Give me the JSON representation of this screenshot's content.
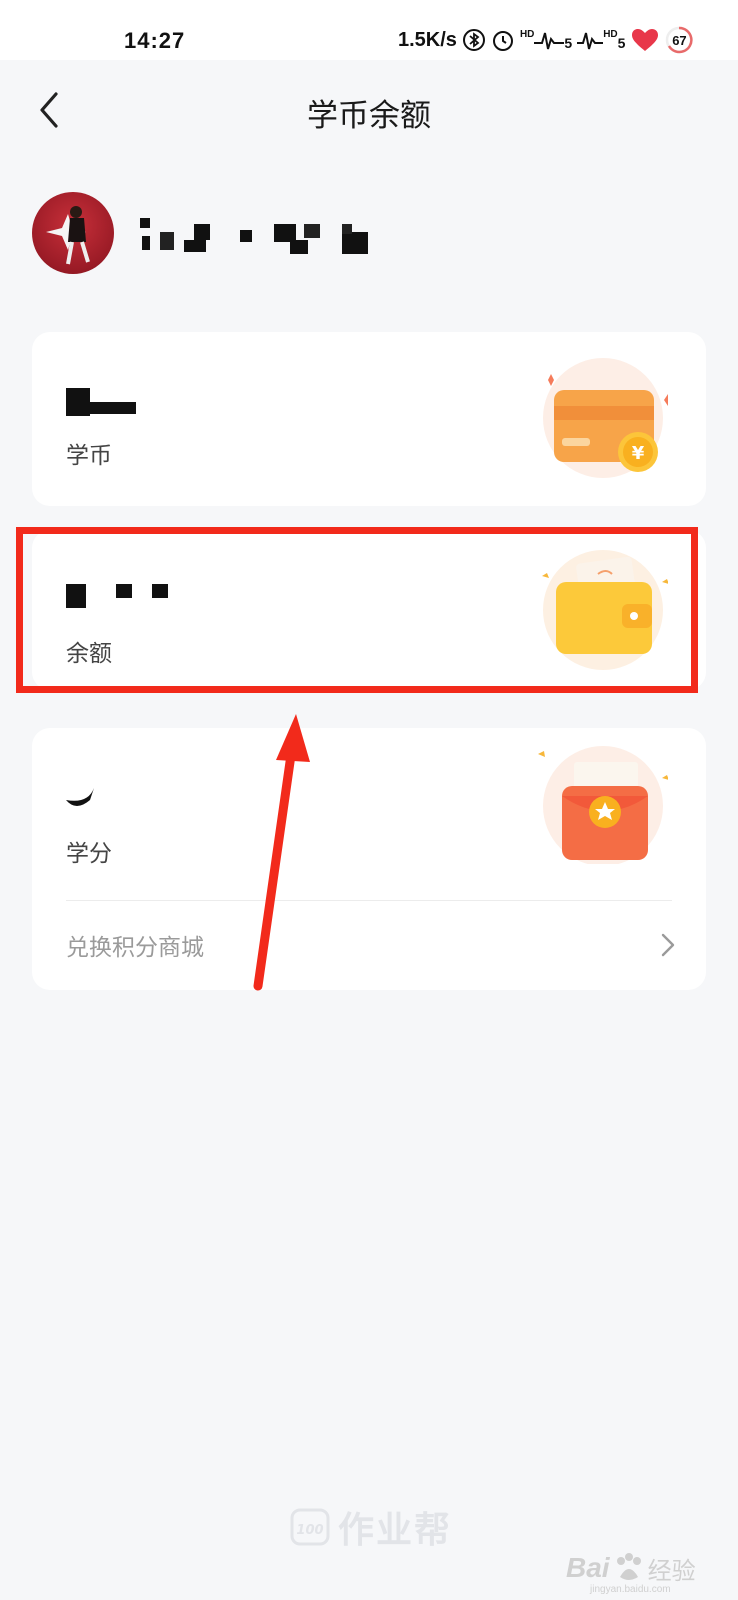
{
  "status_bar": {
    "time": "14:27",
    "net_speed": "1.5K/s",
    "hd1": "HD",
    "signal1": "5",
    "hd2": "HD",
    "signal2": "5",
    "battery": "67"
  },
  "nav": {
    "title": "学币余额",
    "back_icon": "chevron-left-icon"
  },
  "user": {
    "name_redacted": true
  },
  "cards": {
    "coins": {
      "label": "学币",
      "icon": "card-coin-icon"
    },
    "balance": {
      "label": "余额",
      "icon": "wallet-icon"
    },
    "credits": {
      "label": "学分",
      "icon": "red-envelope-icon",
      "link_label": "兑换积分商城",
      "link_icon": "chevron-right-icon"
    }
  },
  "footer": {
    "brand": "作业帮",
    "watermark_latin": "Bai",
    "watermark_cn": "经验",
    "watermark_sub": "jingyan.baidu.com"
  },
  "colors": {
    "highlight": "#f22a1b",
    "background": "#f6f7f9",
    "card_orange": "#f7a449",
    "card_yellow": "#fcc93a",
    "envelope_red": "#f46d45"
  }
}
